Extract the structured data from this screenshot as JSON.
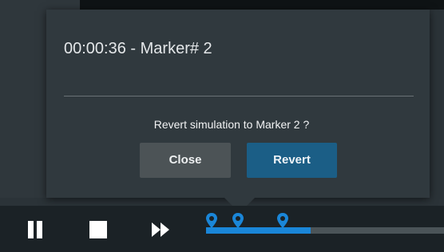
{
  "popup": {
    "title": "00:00:36 - Marker# 2",
    "question": "Revert simulation to Marker 2 ?",
    "close_label": "Close",
    "revert_label": "Revert"
  },
  "toolbar": {
    "icons": [
      "pause-icon",
      "stop-icon",
      "fast-forward-icon"
    ],
    "timeline": {
      "progress_fraction": 0.44,
      "marker_count": 3,
      "marker_icon": "map-pin-icon"
    }
  },
  "colors": {
    "accent": "#1a86d8",
    "revert_button": "#1b5e86",
    "close_button": "#4c5356",
    "popup_background": "#30393e",
    "toolbar_background": "#1b2226"
  }
}
